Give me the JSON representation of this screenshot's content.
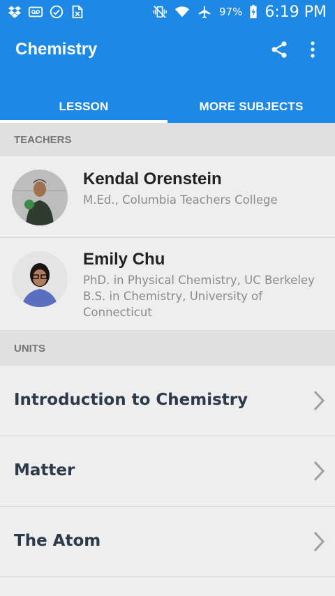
{
  "status_bar": {
    "left_icons": [
      "dropbox-icon",
      "voicemail-icon",
      "check-circle-icon",
      "file-icon"
    ],
    "battery": "97%",
    "time": "6:19 PM"
  },
  "app_bar": {
    "title": "Chemistry",
    "share_icon": "share-icon",
    "more_icon": "more-vert-icon"
  },
  "tabs": [
    {
      "label": "LESSON",
      "active": true
    },
    {
      "label": "MORE SUBJECTS",
      "active": false
    }
  ],
  "teachers_section": {
    "header": "TEACHERS",
    "items": [
      {
        "name": "Kendal Orenstein",
        "credentials": [
          "M.Ed., Columbia Teachers College"
        ]
      },
      {
        "name": "Emily Chu",
        "credentials": [
          "PhD. in Physical Chemistry, UC Berkeley",
          "B.S. in Chemistry, University of Connecticut"
        ]
      }
    ]
  },
  "units_section": {
    "header": "UNITS",
    "items": [
      {
        "label": "Introduction to Chemistry"
      },
      {
        "label": "Matter"
      },
      {
        "label": "The Atom"
      }
    ]
  },
  "colors": {
    "primary": "#1e88e5",
    "background": "#eeeeee",
    "section_header_bg": "#e0e0e0",
    "unit_text": "#2d3a4a"
  }
}
